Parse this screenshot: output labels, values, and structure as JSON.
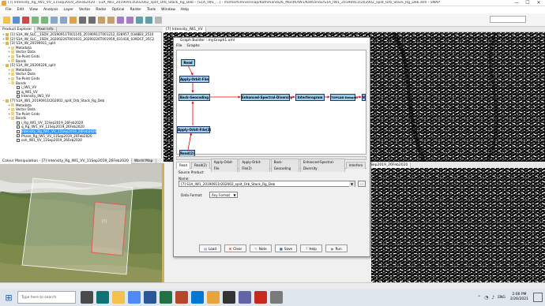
{
  "window": {
    "title": "[7] Intensity_Rg_IW1_VV_11Sep2019_26Feb2020 - S1A_IW1_20190911t202002_split_Orb_Stack_Rg_Deb - [S1A_IW1_...] - /home/himnie/snap/Kathmandu/6_Month/IW1/Kathandu/S1A_IW1_20190911t202002_split_Orb_Stack_Rg_Deb.dim - SNAP",
    "minimize": "—",
    "maximize": "☐",
    "close": "✕"
  },
  "menu": [
    "File",
    "Edit",
    "View",
    "Analysis",
    "Layer",
    "Vector",
    "Radar",
    "Optical",
    "Raster",
    "Tools",
    "Window",
    "Help"
  ],
  "panel_tabs": [
    "Product Explorer",
    "Pixel Info"
  ],
  "tree": [
    {
      "label": "[1] S1A_IW_SLC__1SDV_20190911T001145_20190911T001212_028957_0348B3_2510",
      "indent": 0,
      "exp": "+",
      "icon": "product"
    },
    {
      "label": "[2] S1A_IW_SLC__1SDV_20200226T001931_20200226T001959_031416_039DCF_35C2",
      "indent": 0,
      "exp": "+",
      "icon": "product"
    },
    {
      "label": "[3] S1A_IW_20190911_split",
      "indent": 0,
      "exp": "−",
      "icon": "product"
    },
    {
      "label": "Metadata",
      "indent": 1,
      "exp": "+",
      "icon": "folder"
    },
    {
      "label": "Vector Data",
      "indent": 1,
      "exp": "+",
      "icon": "folder"
    },
    {
      "label": "Tie-Point Grids",
      "indent": 1,
      "exp": "+",
      "icon": "folder"
    },
    {
      "label": "Bands",
      "indent": 1,
      "exp": "+",
      "icon": "folder"
    },
    {
      "label": "[5] S1A_IW_20200226_split",
      "indent": 0,
      "exp": "−",
      "icon": "product"
    },
    {
      "label": "Metadata",
      "indent": 1,
      "exp": "+",
      "icon": "folder"
    },
    {
      "label": "Vector Data",
      "indent": 1,
      "exp": "+",
      "icon": "folder"
    },
    {
      "label": "Tie-Point Grids",
      "indent": 1,
      "exp": "+",
      "icon": "folder"
    },
    {
      "label": "Bands",
      "indent": 1,
      "exp": "−",
      "icon": "folder"
    },
    {
      "label": "i_IW1_VV",
      "indent": 2,
      "exp": "",
      "icon": "band"
    },
    {
      "label": "q_IW1_VV",
      "indent": 2,
      "exp": "",
      "icon": "band"
    },
    {
      "label": "Intensity_IW1_VV",
      "indent": 2,
      "exp": "",
      "icon": "band"
    },
    {
      "label": "[7] S1A_IW1_20190911t202002_split_Orb_Stack_Rg_Deb",
      "indent": 0,
      "exp": "−",
      "icon": "product"
    },
    {
      "label": "Metadata",
      "indent": 1,
      "exp": "+",
      "icon": "folder"
    },
    {
      "label": "Vector Data",
      "indent": 1,
      "exp": "+",
      "icon": "folder"
    },
    {
      "label": "Tie-Point Grids",
      "indent": 1,
      "exp": "+",
      "icon": "folder"
    },
    {
      "label": "Bands",
      "indent": 1,
      "exp": "−",
      "icon": "folder"
    },
    {
      "label": "i_Rg_IW1_VV_11Sep2019_26Feb2020",
      "indent": 2,
      "exp": "",
      "icon": "band"
    },
    {
      "label": "q_Rg_IW1_VV_11Sep2019_26Feb2020",
      "indent": 2,
      "exp": "",
      "icon": "band"
    },
    {
      "label": "Intensity_Rg_IW1_VV_11Sep2019_26Feb2020",
      "indent": 2,
      "exp": "",
      "icon": "band",
      "selected": true
    },
    {
      "label": "Phase_Rg_IW1_VV_11Sep2019_26Feb2020",
      "indent": 2,
      "exp": "",
      "icon": "band"
    },
    {
      "label": "coh_IW1_VV_11Sep2019_26Feb2020",
      "indent": 2,
      "exp": "",
      "icon": "band"
    }
  ],
  "lower_tabs": [
    "Colour Manipulation - [7] Intensity_Rg_IW1_VV_11Sep2019_26Feb2020",
    "World Map"
  ],
  "map_label": "[7]",
  "image_tabs": [
    "[7] Intensity_IW1_VV"
  ],
  "image_tabs2": [
    "_11Sep2019_26Feb2020"
  ],
  "graph_builder": {
    "title": "Graph Builder : myGraph1.xml",
    "menu": [
      "File",
      "Graphs"
    ],
    "nodes": {
      "read": "Read",
      "apply_orbit": "Apply-Orbit-File",
      "back_geocoding": "Back-Geocoding",
      "esd": "Enhanced-Spectral-Diversity",
      "interferogram": "Interferogram",
      "deburst": "TOPSAR-Deburst",
      "write": "Write",
      "apply_orbit2": "Apply-Orbit-File(2)",
      "read2": "Read(2)"
    },
    "tabs": [
      "Read",
      "Read(2)",
      "Apply-Orbit-File",
      "Apply-Orbit-File(2)",
      "Back-Geocoding",
      "Enhanced-Spectral-Diversity",
      "Interfero"
    ],
    "source_product_label": "Source Product",
    "name_label": "Name:",
    "source_value": "[7] S1A_IW1_20190911t202002_split_Orb_Stack_Rg_Deb",
    "browse": "...",
    "data_format_label": "Data Format:",
    "data_format_value": "Any Format",
    "buttons": {
      "load": "Load",
      "clear": "Clear",
      "note": "Note",
      "save": "Save",
      "help": "Help",
      "run": "Run"
    }
  },
  "taskbar": {
    "search_placeholder": "Type here to search",
    "lang": "ENG",
    "time": "2:06 PM",
    "date": "2/26/2021"
  }
}
